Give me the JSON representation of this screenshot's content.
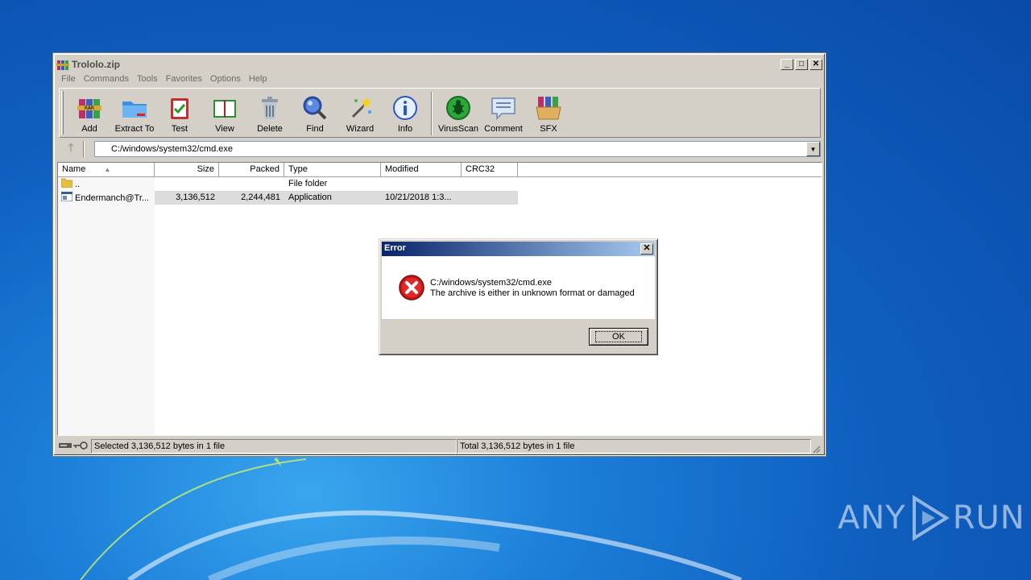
{
  "window": {
    "title": "Trololo.zip",
    "menu": [
      "File",
      "Commands",
      "Tools",
      "Favorites",
      "Options",
      "Help"
    ],
    "toolbar": [
      {
        "label": "Add",
        "icon": "add-archive-icon"
      },
      {
        "label": "Extract To",
        "icon": "extract-folder-icon"
      },
      {
        "label": "Test",
        "icon": "test-clipboard-icon"
      },
      {
        "label": "View",
        "icon": "view-book-icon"
      },
      {
        "label": "Delete",
        "icon": "trash-icon"
      },
      {
        "label": "Find",
        "icon": "magnifier-icon"
      },
      {
        "label": "Wizard",
        "icon": "wand-icon"
      },
      {
        "label": "Info",
        "icon": "info-icon"
      },
      {
        "label": "VirusScan",
        "icon": "virus-scan-icon"
      },
      {
        "label": "Comment",
        "icon": "comment-icon"
      },
      {
        "label": "SFX",
        "icon": "sfx-box-icon"
      }
    ],
    "address": "C:/windows/system32/cmd.exe",
    "columns": {
      "name": "Name",
      "size": "Size",
      "packed": "Packed",
      "type": "Type",
      "modified": "Modified",
      "crc": "CRC32"
    },
    "rows": [
      {
        "name": "..",
        "size": "",
        "packed": "",
        "type": "File folder",
        "modified": "",
        "crc": ""
      },
      {
        "name": "Endermanch@Tr...",
        "size": "3,136,512",
        "packed": "2,244,481",
        "type": "Application",
        "modified": "10/21/2018 1:3...",
        "crc": ""
      }
    ],
    "status": {
      "selected": "Selected 3,136,512 bytes in 1 file",
      "total": "Total 3,136,512 bytes in 1 file"
    }
  },
  "dialog": {
    "title": "Error",
    "line1": "C:/windows/system32/cmd.exe",
    "line2": "The archive is either in unknown format or damaged",
    "ok": "OK"
  },
  "watermark": {
    "left": "ANY",
    "right": "RUN"
  }
}
